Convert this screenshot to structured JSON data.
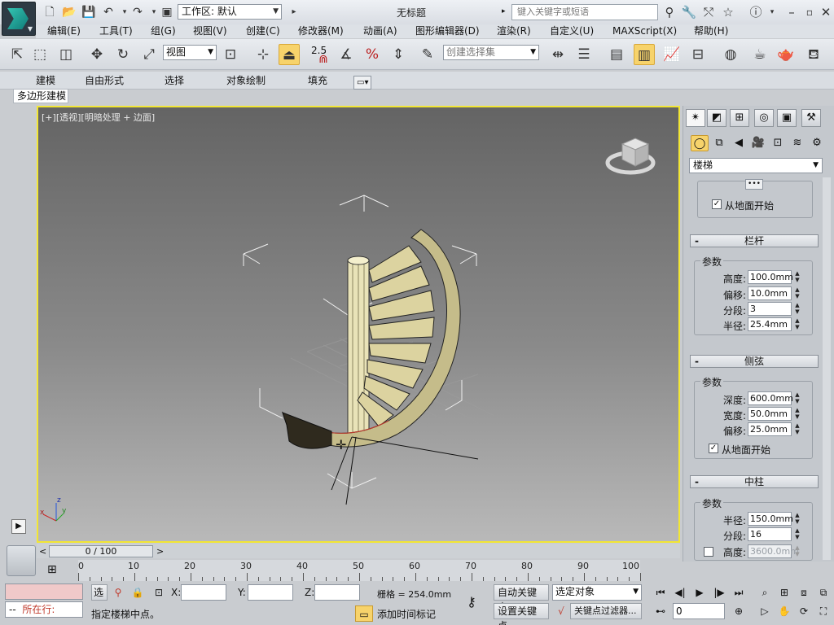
{
  "titlebar": {
    "workspace_value": "工作区: 默认",
    "title": "无标题",
    "search_placeholder": "键入关键字或短语"
  },
  "menus": [
    "编辑(E)",
    "工具(T)",
    "组(G)",
    "视图(V)",
    "创建(C)",
    "修改器(M)",
    "动画(A)",
    "图形编辑器(D)",
    "渲染(R)",
    "自定义(U)",
    "MAXScript(X)",
    "帮助(H)"
  ],
  "toolbar": {
    "ref_coord_value": "视图",
    "snap_value": "2.5",
    "selection_set_placeholder": "创建选择集"
  },
  "ribbon": {
    "tabs": [
      "建模",
      "自由形式",
      "选择",
      "对象绘制",
      "填充"
    ],
    "sub_label": "多边形建模"
  },
  "viewport": {
    "label_parts": [
      "[+]",
      "[透视]",
      "[明暗处理 + 边面]"
    ]
  },
  "command_panel": {
    "object_type": "楼梯",
    "top_checkbox_label": "从地面开始",
    "railing": {
      "title": "栏杆",
      "group": "参数",
      "fields": [
        {
          "label": "高度:",
          "value": "100.0mm"
        },
        {
          "label": "偏移:",
          "value": "10.0mm"
        },
        {
          "label": "分段:",
          "value": "3"
        },
        {
          "label": "半径:",
          "value": "25.4mm"
        }
      ]
    },
    "stringers": {
      "title": "侧弦",
      "group": "参数",
      "fields": [
        {
          "label": "深度:",
          "value": "600.0mm"
        },
        {
          "label": "宽度:",
          "value": "50.0mm"
        },
        {
          "label": "偏移:",
          "value": "25.0mm"
        }
      ],
      "checkbox_label": "从地面开始"
    },
    "center_pole": {
      "title": "中柱",
      "group": "参数",
      "fields": [
        {
          "label": "半径:",
          "value": "150.0mm"
        },
        {
          "label": "分段:",
          "value": "16"
        },
        {
          "label": "高度:",
          "value": "3600.0mm"
        }
      ]
    }
  },
  "timeline": {
    "slider_label": "0 / 100",
    "ticks": [
      "0",
      "10",
      "20",
      "30",
      "40",
      "50",
      "60",
      "70",
      "80",
      "90",
      "100"
    ]
  },
  "status": {
    "mode_label": "所在行:",
    "mode_prefix": "--",
    "select_label": "选",
    "x_label": "X:",
    "y_label": "Y:",
    "z_label": "Z:",
    "grid_text": "栅格 = 254.0mm",
    "auto_key": "自动关键点",
    "set_key": "设置关键点",
    "selected_object": "选定对象",
    "key_filter": "关键点过滤器...",
    "add_time_tag": "添加时间标记",
    "prompt": "指定楼梯中点。",
    "frame_value": "0"
  },
  "colors": {
    "viewport_border": "#f2e634",
    "active_tool": "#f7d36b"
  }
}
